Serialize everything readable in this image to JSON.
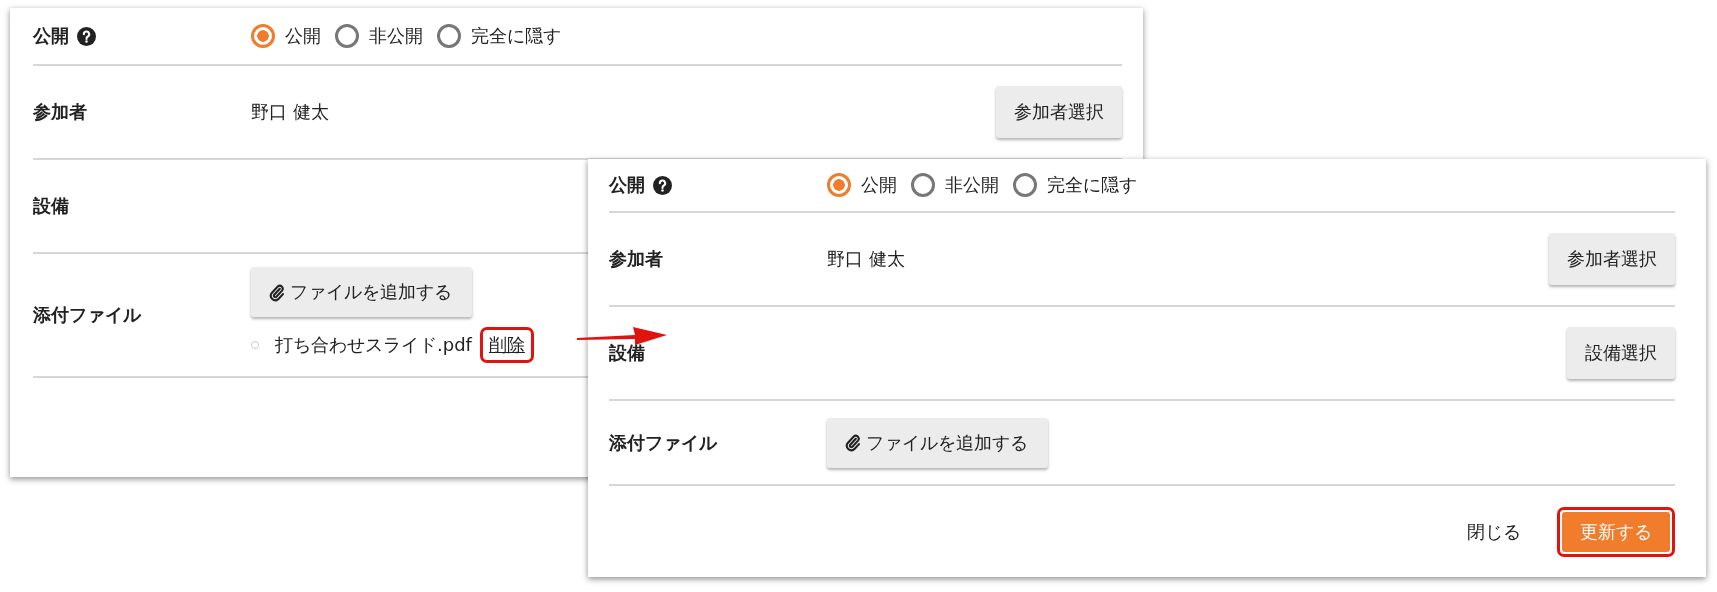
{
  "panels": [
    {
      "rows": [
        {
          "kind": "visibility",
          "label": "公開",
          "options": [
            {
              "label": "公開",
              "selected": true
            },
            {
              "label": "非公開",
              "selected": false
            },
            {
              "label": "完全に隠す",
              "selected": false
            }
          ]
        },
        {
          "kind": "participants",
          "label": "参加者",
          "value": "野口 健太",
          "button": "参加者選択"
        },
        {
          "kind": "facility",
          "label": "設備"
        },
        {
          "kind": "attachments",
          "label": "添付ファイル",
          "add_button": "ファイルを追加する",
          "files": [
            {
              "name": "打ち合わせスライド.pdf",
              "action": "削除",
              "highlighted": true
            }
          ]
        }
      ]
    },
    {
      "rows": [
        {
          "kind": "visibility",
          "label": "公開",
          "options": [
            {
              "label": "公開",
              "selected": true
            },
            {
              "label": "非公開",
              "selected": false
            },
            {
              "label": "完全に隠す",
              "selected": false
            }
          ]
        },
        {
          "kind": "participants",
          "label": "参加者",
          "value": "野口 健太",
          "button": "参加者選択"
        },
        {
          "kind": "facility",
          "label": "設備",
          "button": "設備選択"
        },
        {
          "kind": "attachments",
          "label": "添付ファイル",
          "add_button": "ファイルを追加する"
        }
      ],
      "footer": {
        "close": "閉じる",
        "submit": {
          "label": "更新する",
          "highlighted": true
        }
      }
    }
  ]
}
